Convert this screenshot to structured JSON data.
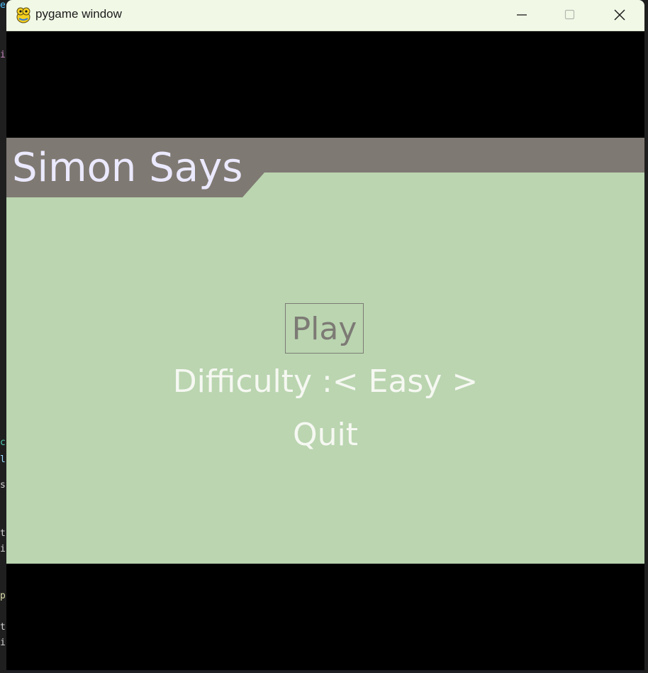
{
  "window": {
    "title": "pygame window"
  },
  "game": {
    "title": "Simon Says",
    "menu": {
      "play_label": "Play",
      "difficulty_label": "Difficulty :< Easy >",
      "quit_label": "Quit"
    }
  },
  "colors": {
    "background": "#000000",
    "panel": "#bad5b0",
    "banner": "#7f7973",
    "title_text": "#ebe9ff",
    "selected_item": "#7d7a75",
    "menu_text": "#f6f8f2",
    "titlebar": "#f1f8e6"
  },
  "icons": {
    "app": "pygame-snake-icon",
    "minimize": "minimize-icon",
    "maximize": "maximize-icon",
    "close": "close-icon"
  }
}
